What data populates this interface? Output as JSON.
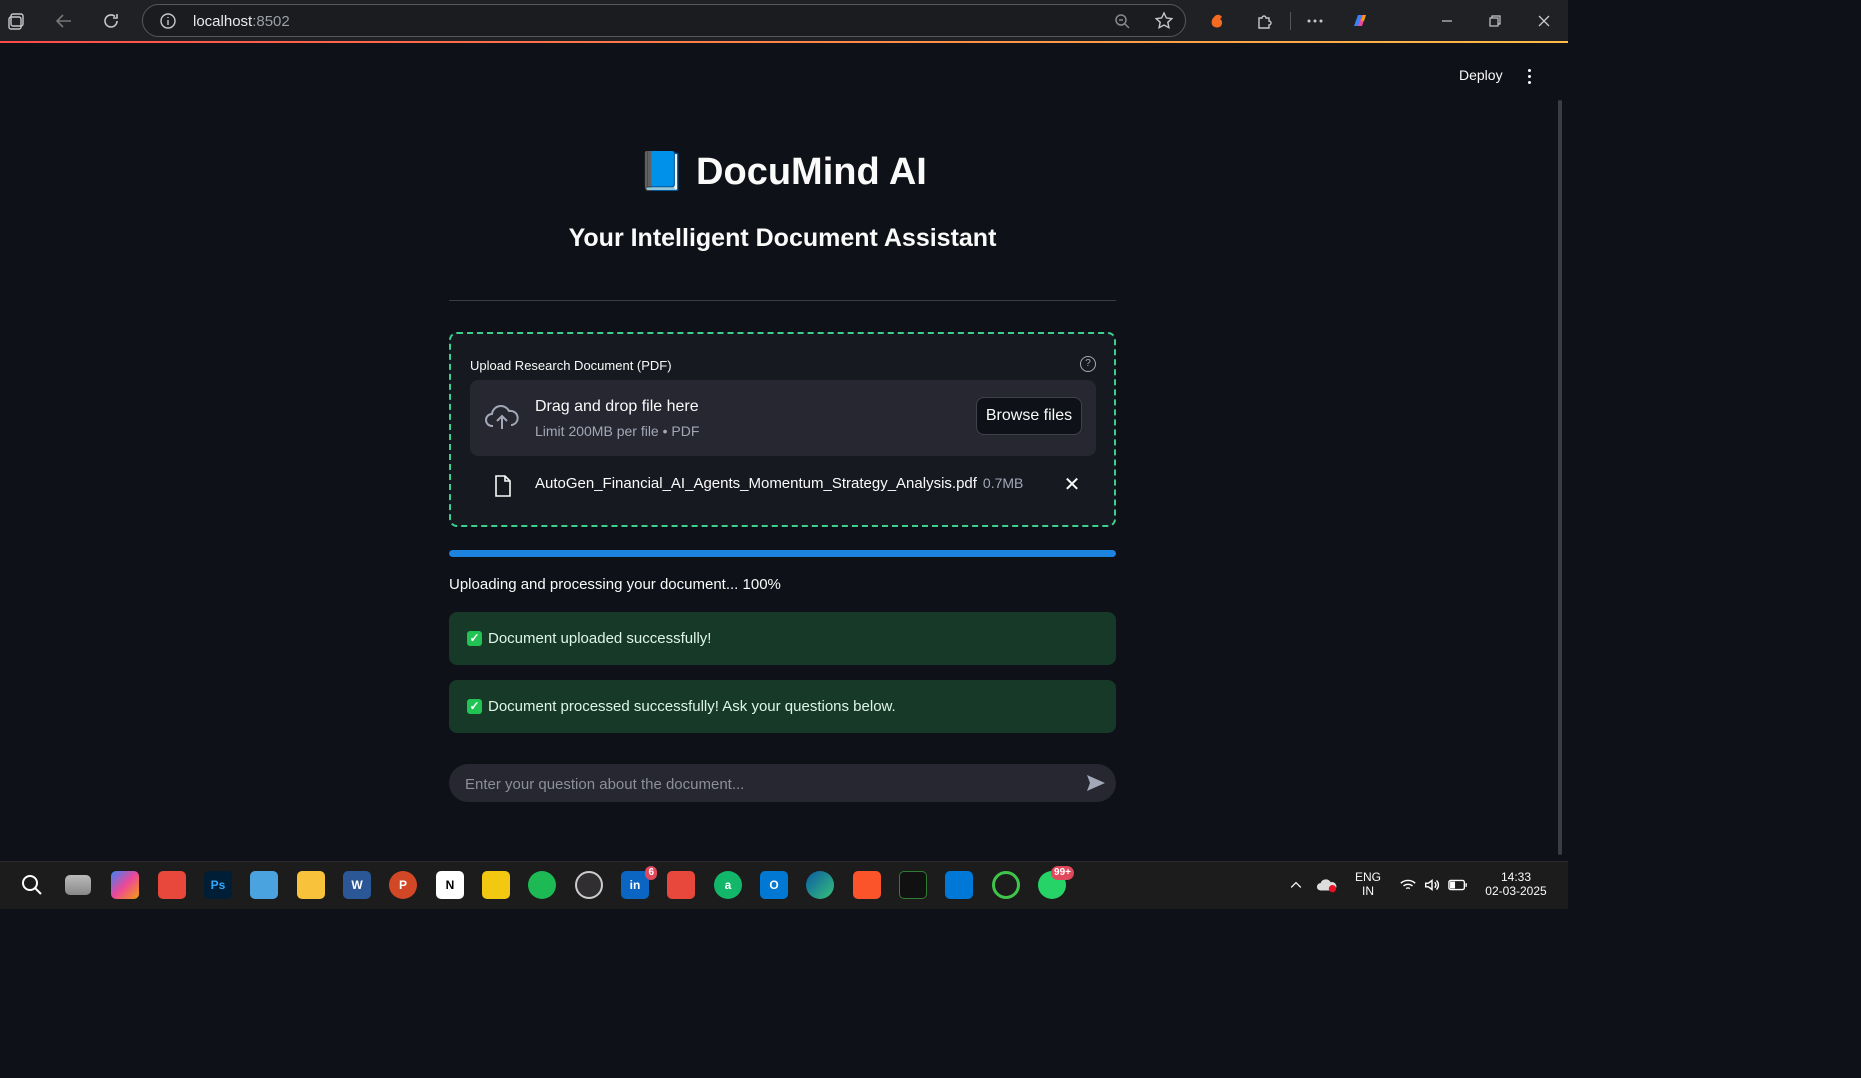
{
  "browser": {
    "url_host": "localhost",
    "url_port": ":8502"
  },
  "header": {
    "deploy_label": "Deploy"
  },
  "main": {
    "title_emoji": "📘",
    "title": "DocuMind AI",
    "subtitle": "Your Intelligent Document Assistant"
  },
  "uploader": {
    "label": "Upload Research Document (PDF)",
    "help_icon": "question-circle-icon",
    "drop_title": "Drag and drop file here",
    "drop_subtitle": "Limit 200MB per file • PDF",
    "browse_label": "Browse files",
    "file_name": "AutoGen_Financial_AI_Agents_Momentum_Strategy_Analysis.pdf",
    "file_size": "0.7MB"
  },
  "progress": {
    "value": 100,
    "text": "Uploading and processing your document... 100%",
    "color": "#1c83e1"
  },
  "alerts": [
    {
      "icon": "✓",
      "text": "Document uploaded successfully!"
    },
    {
      "icon": "✓",
      "text": "Document processed successfully! Ask your questions below."
    }
  ],
  "chat": {
    "placeholder": "Enter your question about the document..."
  },
  "taskbar": {
    "apps": [
      {
        "name": "search",
        "label": ""
      },
      {
        "name": "task-view",
        "label": ""
      },
      {
        "name": "copilot",
        "label": ""
      },
      {
        "name": "app-red",
        "label": ""
      },
      {
        "name": "photoshop",
        "label": "Ps"
      },
      {
        "name": "notepad",
        "label": ""
      },
      {
        "name": "file-explorer",
        "label": ""
      },
      {
        "name": "word",
        "label": "W"
      },
      {
        "name": "powerpoint",
        "label": "P"
      },
      {
        "name": "notion",
        "label": "N"
      },
      {
        "name": "power-bi",
        "label": ""
      },
      {
        "name": "spotify",
        "label": ""
      },
      {
        "name": "obs",
        "label": ""
      },
      {
        "name": "linkedin",
        "label": "in",
        "badge": "6"
      },
      {
        "name": "app-red-2",
        "label": ""
      },
      {
        "name": "app-green",
        "label": "a"
      },
      {
        "name": "outlook",
        "label": "O"
      },
      {
        "name": "edge",
        "label": ""
      },
      {
        "name": "brave",
        "label": ""
      },
      {
        "name": "app-dark",
        "label": ""
      },
      {
        "name": "vscode",
        "label": ""
      },
      {
        "name": "app-ring",
        "label": ""
      },
      {
        "name": "whatsapp",
        "label": "",
        "badge": "99+"
      }
    ],
    "lang_top": "ENG",
    "lang_bottom": "IN",
    "time": "14:33",
    "date": "02-03-2025"
  }
}
